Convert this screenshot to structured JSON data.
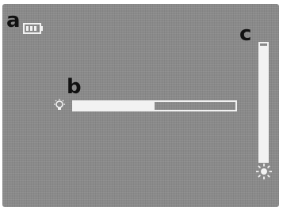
{
  "callouts": {
    "a": "a",
    "b": "b",
    "c": "c"
  },
  "icons": {
    "battery": "battery-icon",
    "backlight": "bulb-icon",
    "brightness": "sun-icon"
  },
  "controls": {
    "backlight_level": 0.5,
    "brightness_level": 0.98
  },
  "colors": {
    "screen": "#8a8a8a",
    "foreground": "#f2f2f2",
    "callout_text": "#111111"
  }
}
